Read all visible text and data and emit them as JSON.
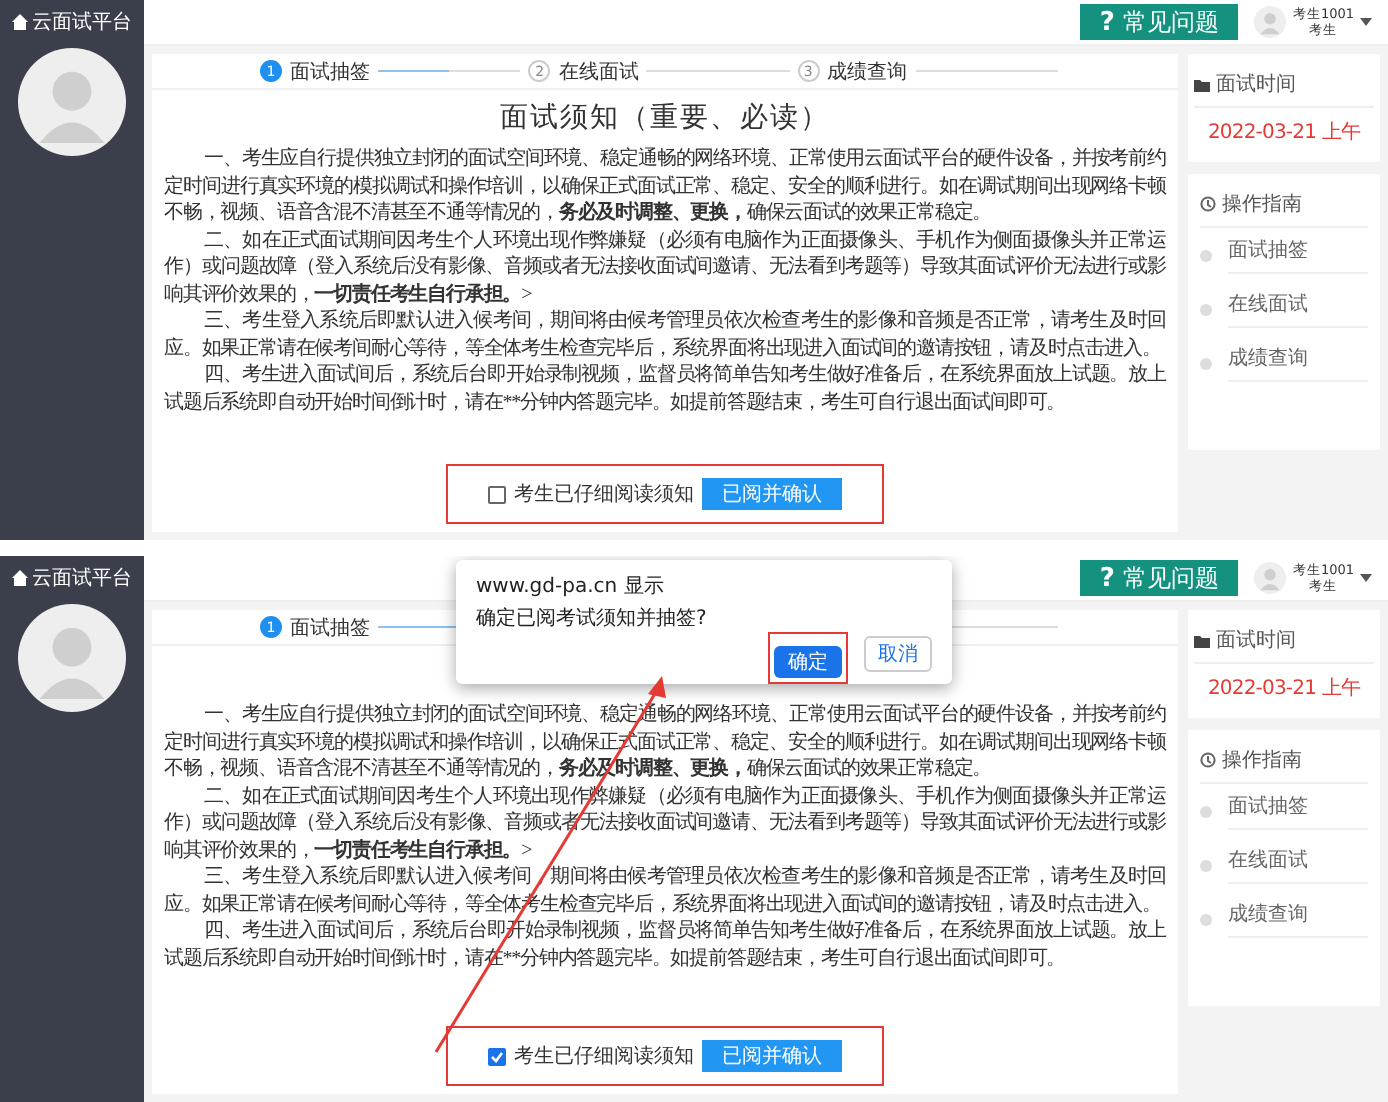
{
  "screens": [
    {
      "sidebar": {
        "title": "云面试平台"
      },
      "header": {
        "help_icon": "?",
        "help_button": "常见问题",
        "user_name": "考生1001",
        "user_role": "考生"
      },
      "steps": [
        {
          "number": "1",
          "label": "面试抽签",
          "selected": true
        },
        {
          "number": "2",
          "label": "在线面试",
          "selected": false
        },
        {
          "number": "3",
          "label": "成绩查询",
          "selected": false
        }
      ],
      "notice": {
        "title": "面试须知（重要、必读）",
        "paragraphs": [
          [
            {
              "text": "一、考生应自行提供独立封闭的面试空间环境、稳定通畅的网络环境、正常使用云面试平台的硬件设备，并按考前约定时间进行真实环境的模拟调试和操作培训，以确保正式面试正常、稳定、安全的顺利进行。如在调试期间出现网络卡顿不畅，视频、语音含混不清甚至不通等情况的，",
              "bold": false
            },
            {
              "text": "务必及时调整、更换，",
              "bold": true
            },
            {
              "text": "确保云面试的效果正常稳定。",
              "bold": false
            }
          ],
          [
            {
              "text": "二、如在正式面试期间因考生个人环境出现作弊嫌疑（必须有电脑作为正面摄像头、手机作为侧面摄像头并正常运作）或问题故障（登入系统后没有影像、音频或者无法接收面试间邀请、无法看到考题等）导致其面试评价无法进行或影响其评价效果的，",
              "bold": false
            },
            {
              "text": "一切责任考生自行承担。",
              "bold": true
            },
            {
              "text": ">",
              "bold": false
            }
          ],
          [
            {
              "text": "三、考生登入系统后即默认进入候考间，期间将由候考管理员依次检查考生的影像和音频是否正常，请考生及时回应。如果正常请在候考间耐心等待，等全体考生检查完毕后，系统界面将出现进入面试间的邀请按钮，请及时点击进入。",
              "bold": false
            }
          ],
          [
            {
              "text": "四、考生进入面试间后，系统后台即开始录制视频，监督员将简单告知考生做好准备后，在系统界面放上试题。放上试题后系统即自动开始时间倒计时，请在**分钟内答题完毕。如提前答题结束，考生可自行退出面试间即可。",
              "bold": false
            }
          ]
        ]
      },
      "agreement": {
        "label": "考生已仔细阅读须知",
        "checked": false,
        "button": "已阅并确认"
      },
      "side_panel": {
        "time_title": "面试时间",
        "time": "2022-03-21 上午",
        "guide_title": "操作指南",
        "guide_items": [
          "面试抽签",
          "在线面试",
          "成绩查询"
        ]
      }
    },
    {
      "sidebar": {
        "title": "云面试平台"
      },
      "header": {
        "help_icon": "?",
        "help_button": "常见问题",
        "user_name": "考生1001",
        "user_role": "考生"
      },
      "steps": [
        {
          "number": "1",
          "label": "面试抽签",
          "selected": true
        }
      ],
      "notice": {
        "paragraphs": [
          [
            {
              "text": "一、考生应自行提供独立封闭的面试空间环境、稳定通畅的网络环境、正常使用云面试平台的硬件设备，并按考前约定时间进行真实环境的模拟调试和操作培训，以确保正式面试正常、稳定、安全的顺利进行。如在调试期间出现网络卡顿不畅，视频、语音含混不清甚至不通等情况的，",
              "bold": false
            },
            {
              "text": "务必及时调整、更换，",
              "bold": true
            },
            {
              "text": "确保云面试的效果正常稳定。",
              "bold": false
            }
          ],
          [
            {
              "text": "二、如在正式面试期间因考生个人环境出现作弊嫌疑（必须有电脑作为正面摄像头、手机作为侧面摄像头并正常运作）或问题故障（登入系统后没有影像、音频或者无法接收面试间邀请、无法看到考题等）导致其面试评价无法进行或影响其评价效果的，",
              "bold": false
            },
            {
              "text": "一切责任考生自行承担。",
              "bold": true
            },
            {
              "text": ">",
              "bold": false
            }
          ],
          [
            {
              "text": "三、考生登入系统后即默认进入候考间，期间将由候考管理员依次检查考生的影像和音频是否正常，请考生及时回应。如果正常请在候考间耐心等待，等全体考生检查完毕后，系统界面将出现进入面试间的邀请按钮，请及时点击进入。",
              "bold": false
            }
          ],
          [
            {
              "text": "四、考生进入面试间后，系统后台即开始录制视频，监督员将简单告知考生做好准备后，在系统界面放上试题。放上试题后系统即自动开始时间倒计时，请在**分钟内答题完毕。如提前答题结束，考生可自行退出面试间即可。",
              "bold": false
            }
          ]
        ]
      },
      "agreement": {
        "label": "考生已仔细阅读须知",
        "checked": true,
        "button": "已阅并确认"
      },
      "side_panel": {
        "time_title": "面试时间",
        "time": "2022-03-21 上午",
        "guide_title": "操作指南",
        "guide_items": [
          "面试抽签",
          "在线面试",
          "成绩查询"
        ]
      },
      "dialog": {
        "title": "www.gd-pa.cn 显示",
        "message": "确定已阅考试须知并抽签?",
        "confirm": "确定",
        "cancel": "取消"
      },
      "annotation": {
        "kind": "arrow"
      }
    }
  ]
}
